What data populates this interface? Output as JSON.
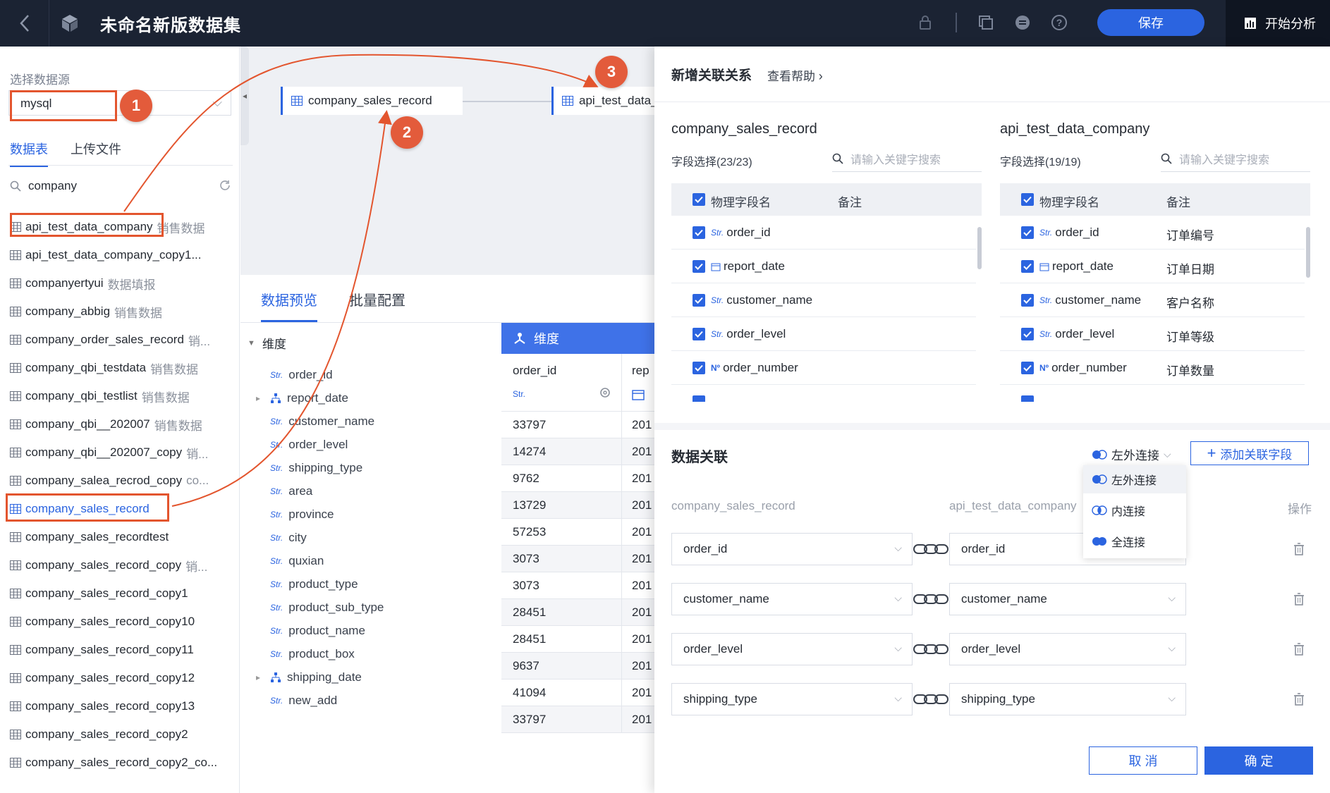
{
  "header": {
    "title": "未命名新版数据集",
    "save_label": "保存",
    "analyze_label": "开始分析"
  },
  "left": {
    "source_label": "选择数据源",
    "source_value": "mysql",
    "tabs": [
      "数据表",
      "上传文件"
    ],
    "search_value": "company",
    "tables": [
      {
        "name": "api_test_data_company",
        "remark": "销售数据"
      },
      {
        "name": "api_test_data_company_copy1...",
        "remark": ""
      },
      {
        "name": "companyertyui",
        "remark": "数据填报"
      },
      {
        "name": "company_abbig",
        "remark": "销售数据"
      },
      {
        "name": "company_order_sales_record",
        "remark": "销..."
      },
      {
        "name": "company_qbi_testdata",
        "remark": "销售数据"
      },
      {
        "name": "company_qbi_testlist",
        "remark": "销售数据"
      },
      {
        "name": "company_qbi__202007",
        "remark": "销售数据"
      },
      {
        "name": "company_qbi__202007_copy",
        "remark": "销..."
      },
      {
        "name": "company_salea_recrod_copy",
        "remark": "co..."
      },
      {
        "name": "company_sales_record",
        "remark": ""
      },
      {
        "name": "company_sales_recordtest",
        "remark": ""
      },
      {
        "name": "company_sales_record_copy",
        "remark": "销..."
      },
      {
        "name": "company_sales_record_copy1",
        "remark": ""
      },
      {
        "name": "company_sales_record_copy10",
        "remark": ""
      },
      {
        "name": "company_sales_record_copy11",
        "remark": ""
      },
      {
        "name": "company_sales_record_copy12",
        "remark": ""
      },
      {
        "name": "company_sales_record_copy13",
        "remark": ""
      },
      {
        "name": "company_sales_record_copy2",
        "remark": ""
      },
      {
        "name": "company_sales_record_copy2_co...",
        "remark": ""
      }
    ]
  },
  "canvas": {
    "node1": "company_sales_record",
    "node2": "api_test_data_"
  },
  "preview": {
    "tabs": [
      "数据预览",
      "批量配置"
    ],
    "dim_label": "维度",
    "fields": [
      {
        "type": "Str.",
        "name": "order_id",
        "expand": false
      },
      {
        "type": "tree",
        "name": "report_date",
        "expand": true
      },
      {
        "type": "Str.",
        "name": "customer_name",
        "expand": false
      },
      {
        "type": "Str.",
        "name": "order_level",
        "expand": false
      },
      {
        "type": "Str.",
        "name": "shipping_type",
        "expand": false
      },
      {
        "type": "Str.",
        "name": "area",
        "expand": false
      },
      {
        "type": "Str.",
        "name": "province",
        "expand": false
      },
      {
        "type": "Str.",
        "name": "city",
        "expand": false
      },
      {
        "type": "Str.",
        "name": "quxian",
        "expand": false
      },
      {
        "type": "Str.",
        "name": "product_type",
        "expand": false
      },
      {
        "type": "Str.",
        "name": "product_sub_type",
        "expand": false
      },
      {
        "type": "Str.",
        "name": "product_name",
        "expand": false
      },
      {
        "type": "Str.",
        "name": "product_box",
        "expand": false
      },
      {
        "type": "tree",
        "name": "shipping_date",
        "expand": true
      },
      {
        "type": "Str.",
        "name": "new_add",
        "expand": false
      }
    ],
    "table_header": "维度",
    "col1_name": "order_id",
    "col1_type": "Str.",
    "col2_name": "rep",
    "order_ids": [
      "33797",
      "14274",
      "9762",
      "13729",
      "57253",
      "3073",
      "3073",
      "28451",
      "28451",
      "9637",
      "41094",
      "33797"
    ],
    "col2_value": "201"
  },
  "dialog": {
    "title": "新增关联关系",
    "help": "查看帮助",
    "left_table": "company_sales_record",
    "right_table": "api_test_data_company",
    "left_select": "字段选择(23/23)",
    "right_select": "字段选择(19/19)",
    "search_placeholder": "请输入关键字搜索",
    "col_field": "物理字段名",
    "col_remark": "备注",
    "left_fields": [
      {
        "type": "Str.",
        "name": "order_id",
        "remark": ""
      },
      {
        "type": "date",
        "name": "report_date",
        "remark": ""
      },
      {
        "type": "Str.",
        "name": "customer_name",
        "remark": ""
      },
      {
        "type": "Str.",
        "name": "order_level",
        "remark": ""
      },
      {
        "type": "Nº",
        "name": "order_number",
        "remark": ""
      }
    ],
    "right_fields": [
      {
        "type": "Str.",
        "name": "order_id",
        "remark": "订单编号"
      },
      {
        "type": "date",
        "name": "report_date",
        "remark": "订单日期"
      },
      {
        "type": "Str.",
        "name": "customer_name",
        "remark": "客户名称"
      },
      {
        "type": "Str.",
        "name": "order_level",
        "remark": "订单等级"
      },
      {
        "type": "Nº",
        "name": "order_number",
        "remark": "订单数量"
      }
    ],
    "relation_title": "数据关联",
    "join_type": "左外连接",
    "add_label": "添加关联字段",
    "join_options": [
      "左外连接",
      "内连接",
      "全连接"
    ],
    "rel_left_hdr": "company_sales_record",
    "rel_right_hdr": "api_test_data_company",
    "rel_op_hdr": "操作",
    "relations": [
      {
        "left": "order_id",
        "right": "order_id"
      },
      {
        "left": "customer_name",
        "right": "customer_name"
      },
      {
        "left": "order_level",
        "right": "order_level"
      },
      {
        "left": "shipping_type",
        "right": "shipping_type"
      }
    ],
    "cancel": "取 消",
    "confirm": "确 定"
  },
  "annotations": [
    "1",
    "2",
    "3"
  ],
  "colors": {
    "accent": "#2b64e0",
    "annotation": "#e35b3b",
    "topbar": "#1b2333"
  }
}
